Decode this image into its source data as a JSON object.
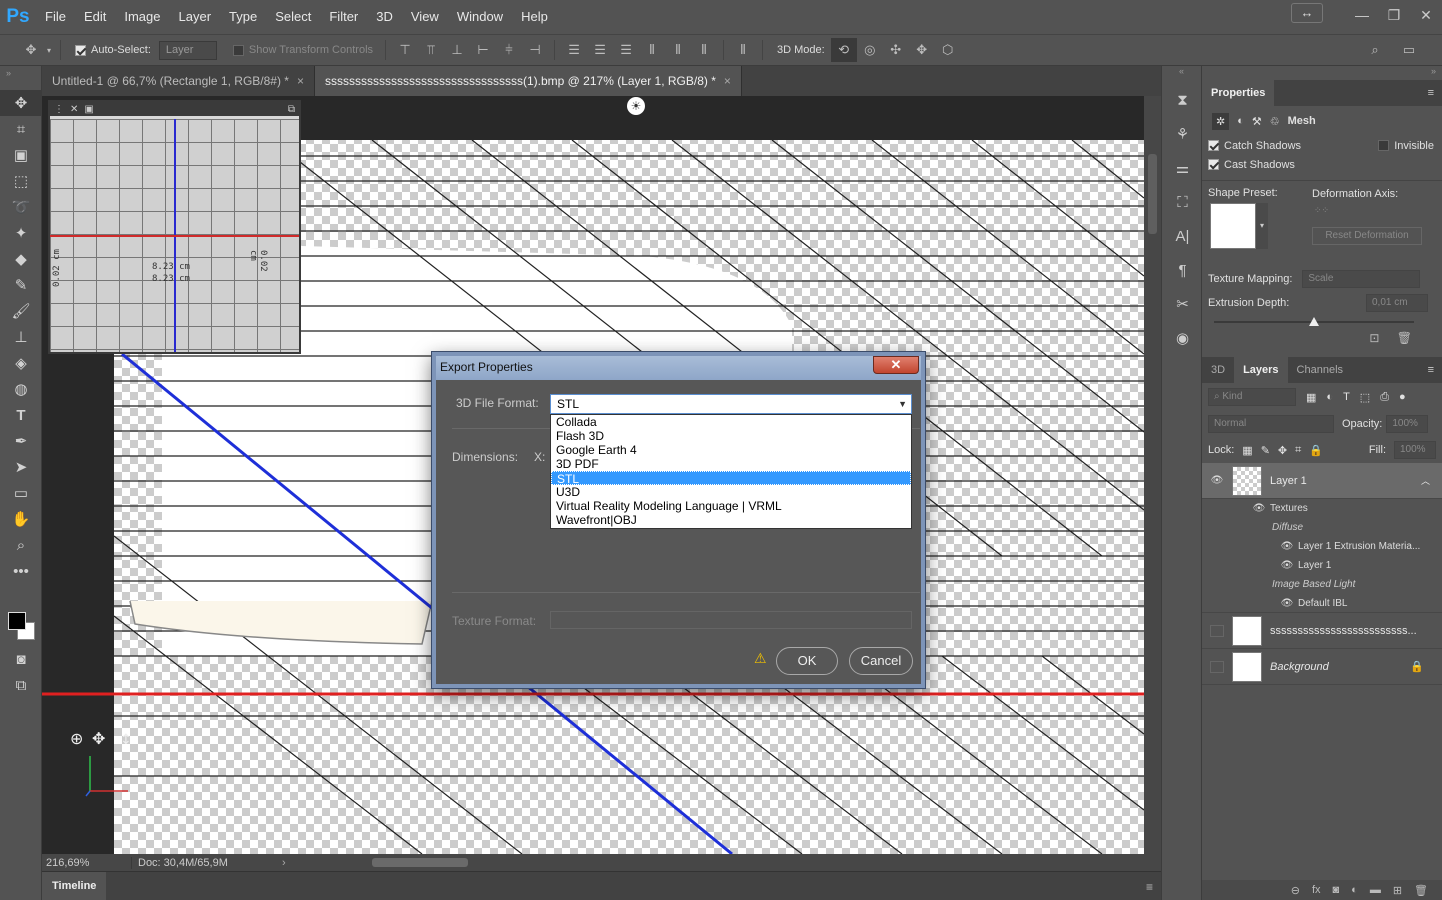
{
  "menubar": {
    "logo": "Ps",
    "items": [
      "File",
      "Edit",
      "Image",
      "Layer",
      "Type",
      "Select",
      "Filter",
      "3D",
      "View",
      "Window",
      "Help"
    ]
  },
  "options_bar": {
    "auto_select_label": "Auto-Select:",
    "auto_select_value": "Layer",
    "show_transform_label": "Show Transform Controls",
    "mode_3d_label": "3D Mode:"
  },
  "tabs": [
    {
      "label": "Untitled-1 @ 66,7% (Rectangle 1, RGB/8#) *",
      "close": "×"
    },
    {
      "label": "sssssssssssssssssssssssssssssssss(1).bmp @ 217% (Layer 1, RGB/8) *",
      "close": "×"
    }
  ],
  "measure_panel": {
    "left_value": "0.02 cm",
    "right_value": "0.02 cm",
    "center_value_1": "8.23 cm",
    "center_value_2": "8.23 cm"
  },
  "status": {
    "zoom": "216,69%",
    "doc_size": "Doc: 30,4M/65,9M"
  },
  "timeline": {
    "label": "Timeline"
  },
  "properties_panel": {
    "title": "Properties",
    "mesh_label": "Mesh",
    "catch_shadows": "Catch Shadows",
    "invisible": "Invisible",
    "cast_shadows": "Cast Shadows",
    "shape_preset": "Shape Preset:",
    "deformation_axis": "Deformation Axis:",
    "reset_deformation": "Reset Deformation",
    "texture_mapping_label": "Texture Mapping:",
    "texture_mapping_value": "Scale",
    "extrusion_depth_label": "Extrusion Depth:",
    "extrusion_depth_value": "0,01 cm",
    "extrusion_depth_fraction": 0.5
  },
  "layers_panel": {
    "tabs": [
      "3D",
      "Layers",
      "Channels"
    ],
    "active_tab": "Layers",
    "kind_label": "Kind",
    "blend_mode": "Normal",
    "opacity_label": "Opacity:",
    "opacity_value": "100%",
    "lock_label": "Lock:",
    "fill_label": "Fill:",
    "fill_value": "100%",
    "layers": [
      {
        "name": "Layer 1",
        "selected": true
      },
      {
        "name": "sssssssssssssssssssssssss...",
        "selected": false
      },
      {
        "name": "Background",
        "selected": false
      }
    ],
    "sublayers": {
      "textures": "Textures",
      "diffuse": "Diffuse",
      "extrusion_material": "Layer 1 Extrusion Materia...",
      "layer1": "Layer 1",
      "ibl": "Image Based Light",
      "default_ibl": "Default IBL"
    }
  },
  "dialog": {
    "title": "Export Properties",
    "close": "✕",
    "format_label": "3D File Format:",
    "format_value": "STL",
    "options": [
      "Collada",
      "Flash 3D",
      "Google Earth 4",
      "3D PDF",
      "STL",
      "U3D",
      "Virtual Reality Modeling Language | VRML",
      "Wavefront|OBJ"
    ],
    "selected_option": "STL",
    "dimensions_label": "Dimensions:",
    "x_label": "X:",
    "texture_format_label": "Texture Format:",
    "ok": "OK",
    "cancel": "Cancel"
  },
  "colors": {
    "accent": "#31a8ff",
    "guide_red": "#e02020",
    "guide_blue": "#1e2fd8",
    "selection_blue": "#3399ff"
  }
}
